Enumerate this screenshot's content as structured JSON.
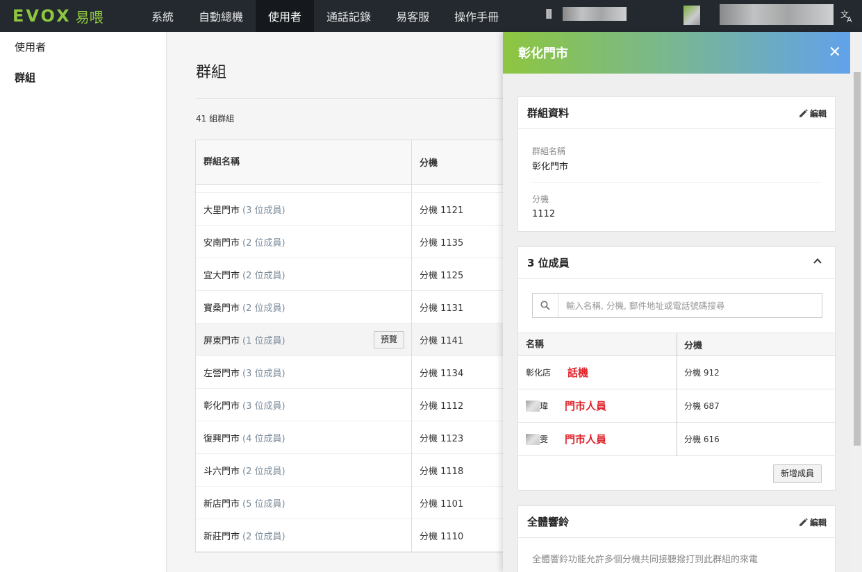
{
  "nav": {
    "logo_text": "EVOX",
    "logo_cn": "易喂",
    "items": [
      {
        "label": "系統",
        "active": false
      },
      {
        "label": "自動總機",
        "active": false
      },
      {
        "label": "使用者",
        "active": true
      },
      {
        "label": "通話記錄",
        "active": false
      },
      {
        "label": "易客服",
        "active": false
      },
      {
        "label": "操作手冊",
        "active": false
      }
    ],
    "language_icon": "translate-icon"
  },
  "sidebar": {
    "items": [
      {
        "label": "使用者"
      },
      {
        "label": "群組"
      }
    ]
  },
  "main": {
    "title": "群組",
    "count_text": "41 組群組",
    "columns": [
      "群組名稱",
      "分機"
    ],
    "rows": [
      {
        "name": "大里門市",
        "members": "(3 位成員)",
        "ext": "分機 1121"
      },
      {
        "name": "安南門市",
        "members": "(2 位成員)",
        "ext": "分機 1135"
      },
      {
        "name": "宜大門市",
        "members": "(2 位成員)",
        "ext": "分機 1125"
      },
      {
        "name": "寶桑門市",
        "members": "(2 位成員)",
        "ext": "分機 1131"
      },
      {
        "name": "屏東門市",
        "members": "(1 位成員)",
        "ext": "分機 1141",
        "preview_label": "預覽"
      },
      {
        "name": "左營門市",
        "members": "(3 位成員)",
        "ext": "分機 1134"
      },
      {
        "name": "彰化門市",
        "members": "(3 位成員)",
        "ext": "分機 1112"
      },
      {
        "name": "復興門市",
        "members": "(4 位成員)",
        "ext": "分機 1123"
      },
      {
        "name": "斗六門市",
        "members": "(2 位成員)",
        "ext": "分機 1118"
      },
      {
        "name": "新店門市",
        "members": "(5 位成員)",
        "ext": "分機 1101"
      },
      {
        "name": "新莊門市",
        "members": "(2 位成員)",
        "ext": "分機 1110"
      }
    ]
  },
  "drawer": {
    "title": "彰化門市",
    "group_card": {
      "title": "群組資料",
      "edit_label": "編輯",
      "name_label": "群組名稱",
      "name_value": "彰化門市",
      "ext_label": "分機",
      "ext_value": "1112"
    },
    "members_card": {
      "title": "3 位成員",
      "search_placeholder": "輸入名稱, 分機, 郵件地址或電話號碼搜尋",
      "columns": [
        "名稱",
        "分機"
      ],
      "rows": [
        {
          "name": "彰化店",
          "role": "話機",
          "ext": "分機 912"
        },
        {
          "name": "瑋",
          "role": "門市人員",
          "ext": "分機 687"
        },
        {
          "name": "雯",
          "role": "門市人員",
          "ext": "分機 616"
        }
      ],
      "add_label": "新增成員"
    },
    "ring_card": {
      "title": "全體響鈴",
      "edit_label": "編輯",
      "description": "全體響鈴功能允許多個分機共同接聽撥打到此群組的來電"
    }
  }
}
